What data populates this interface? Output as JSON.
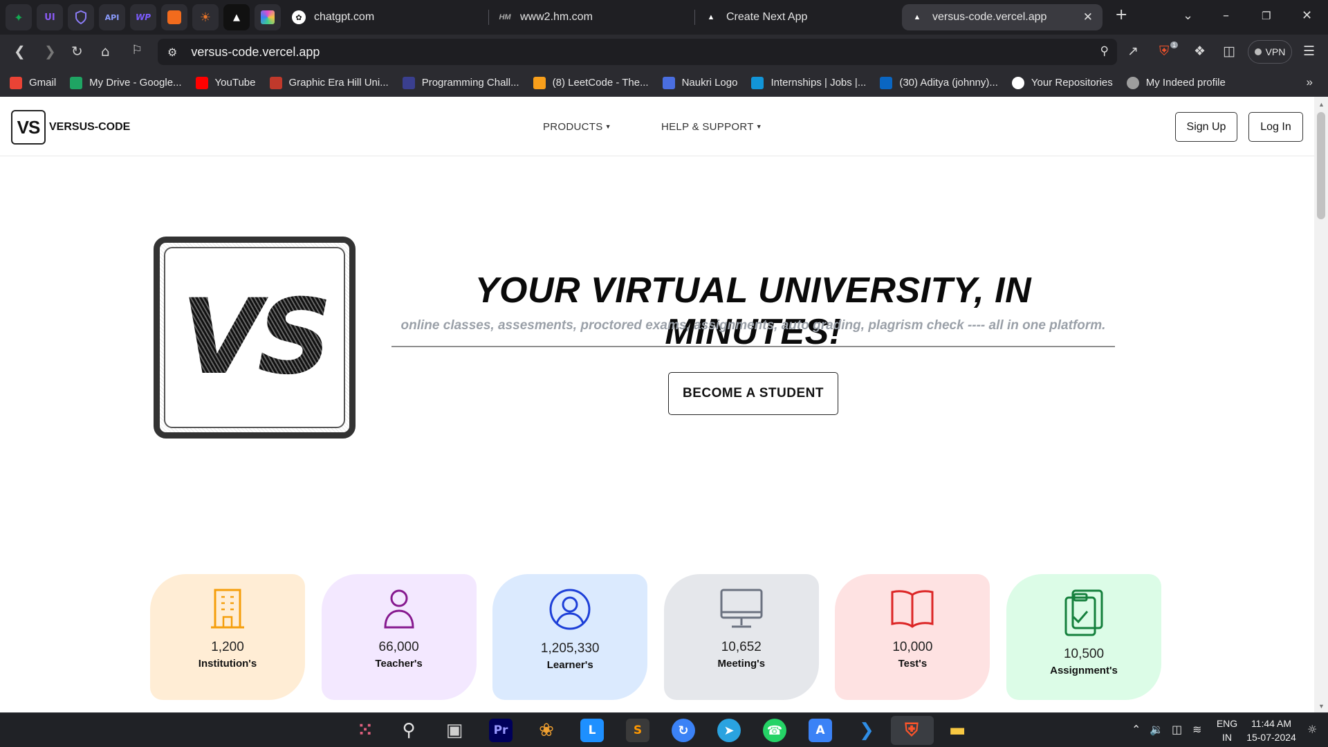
{
  "browser": {
    "tabs": [
      {
        "title": "chatgpt.com",
        "favicon": "chatgpt-icon"
      },
      {
        "title": "www2.hm.com",
        "favicon": "hm-icon"
      },
      {
        "title": "Create Next App",
        "favicon": "vercel-triangle-icon"
      },
      {
        "title": "versus-code.vercel.app",
        "favicon": "vercel-triangle-icon",
        "active": true
      }
    ],
    "pinned_tabs": [
      {
        "label": "",
        "icon": "mongodb-leaf-icon",
        "color": "#13aa52"
      },
      {
        "label": "UI",
        "icon": "ui-icon",
        "color": "#8b5cf6"
      },
      {
        "label": "",
        "icon": "shield-icon",
        "color": "#8b7cf6"
      },
      {
        "label": "API",
        "icon": "api-icon",
        "color": "#8b9cff"
      },
      {
        "label": "WP",
        "icon": "wp-icon",
        "color": "#7c5cff"
      },
      {
        "label": "",
        "icon": "orange-app-icon",
        "color": "#f26b1d"
      },
      {
        "label": "",
        "icon": "sun-icon",
        "color": "#e8752a"
      },
      {
        "label": "",
        "icon": "vercel-triangle-icon",
        "color": "#ffffff"
      },
      {
        "label": "",
        "icon": "colorful-grid-icon",
        "color": "#e24ccf"
      }
    ],
    "address": "versus-code.vercel.app",
    "brave_badge": "1",
    "vpn_label": "VPN",
    "bookmarks": [
      {
        "label": "Gmail",
        "icon": "gmail-icon",
        "color": "#ea4335"
      },
      {
        "label": "My Drive - Google...",
        "icon": "google-drive-icon",
        "color": "#1fa463"
      },
      {
        "label": "YouTube",
        "icon": "youtube-icon",
        "color": "#ff0000"
      },
      {
        "label": "Graphic Era Hill Uni...",
        "icon": "university-icon",
        "color": "#c0392b"
      },
      {
        "label": "Programming Chall...",
        "icon": "programming-icon",
        "color": "#3a3f8f"
      },
      {
        "label": "(8) LeetCode - The...",
        "icon": "leetcode-icon",
        "color": "#f89f1b"
      },
      {
        "label": "Naukri Logo",
        "icon": "naukri-icon",
        "color": "#4a6ee0"
      },
      {
        "label": "Internships | Jobs |...",
        "icon": "internshala-icon",
        "color": "#1295d8"
      },
      {
        "label": "(30) Aditya (johnny)...",
        "icon": "linkedin-icon",
        "color": "#0a66c2"
      },
      {
        "label": "Your Repositories",
        "icon": "github-icon",
        "color": "#ffffff"
      },
      {
        "label": "My Indeed profile",
        "icon": "globe-icon",
        "color": "#9e9e9e"
      }
    ]
  },
  "site": {
    "logo_text": "VS",
    "brand": "VERSUS-CODE",
    "nav": [
      {
        "label": "PRODUCTS"
      },
      {
        "label": "HELP & SUPPORT"
      }
    ],
    "signup_label": "Sign Up",
    "login_label": "Log In",
    "hero": {
      "logo_text": "VS",
      "title": "YOUR VIRTUAL UNIVERSITY, IN MINUTES!",
      "subtitle": "online classes, assesments, proctored exams, assignments, auto grading, plagrism check ---- all in one platform.",
      "cta_label": "BECOME A STUDENT"
    },
    "stats": [
      {
        "value": "1,200",
        "label": "Institution's",
        "icon": "building-icon",
        "bg": "#ffedd5",
        "color": "#f59e0b"
      },
      {
        "value": "66,000",
        "label": "Teacher's",
        "icon": "user-icon",
        "bg": "#f3e8ff",
        "color": "#86198f"
      },
      {
        "value": "1,205,330",
        "label": "Learner's",
        "icon": "user-circle-icon",
        "bg": "#dbeafe",
        "color": "#1d3fd8"
      },
      {
        "value": "10,652",
        "label": "Meeting's",
        "icon": "monitor-icon",
        "bg": "#e5e7eb",
        "color": "#6b7280"
      },
      {
        "value": "10,000",
        "label": "Test's",
        "icon": "book-open-icon",
        "bg": "#fee2e2",
        "color": "#dc2626"
      },
      {
        "value": "10,500",
        "label": "Assignment's",
        "icon": "clipboard-check-icon",
        "bg": "#dcfce7",
        "color": "#15803d"
      }
    ]
  },
  "taskbar": {
    "apps": [
      {
        "icon": "apps-grid-icon",
        "label": "",
        "color": "#e0607e"
      },
      {
        "icon": "search-icon",
        "label": "",
        "color": "#e4e4e4"
      },
      {
        "icon": "task-view-icon",
        "label": "",
        "color": "#cfcfcf"
      },
      {
        "icon": "premiere-pro-icon",
        "label": "Pr",
        "color": "#9999ff"
      },
      {
        "icon": "davinci-resolve-icon",
        "label": "",
        "color": "#f0a030"
      },
      {
        "icon": "l-app-icon",
        "label": "L",
        "color": "#1e90ff"
      },
      {
        "icon": "sublime-text-icon",
        "label": "S",
        "color": "#ff9800"
      },
      {
        "icon": "sync-icon",
        "label": "",
        "color": "#3b82f6"
      },
      {
        "icon": "telegram-icon",
        "label": "",
        "color": "#2aa3e0"
      },
      {
        "icon": "whatsapp-icon",
        "label": "",
        "color": "#25d366"
      },
      {
        "icon": "app-store-icon",
        "label": "A",
        "color": "#3b82f6"
      },
      {
        "icon": "vscode-icon",
        "label": "",
        "color": "#2f8ee6"
      },
      {
        "icon": "brave-icon",
        "label": "",
        "color": "#fb542b"
      },
      {
        "icon": "file-explorer-icon",
        "label": "",
        "color": "#f7c842"
      }
    ],
    "lang_top": "ENG",
    "lang_bottom": "IN",
    "time": "11:44 AM",
    "date": "15-07-2024"
  }
}
